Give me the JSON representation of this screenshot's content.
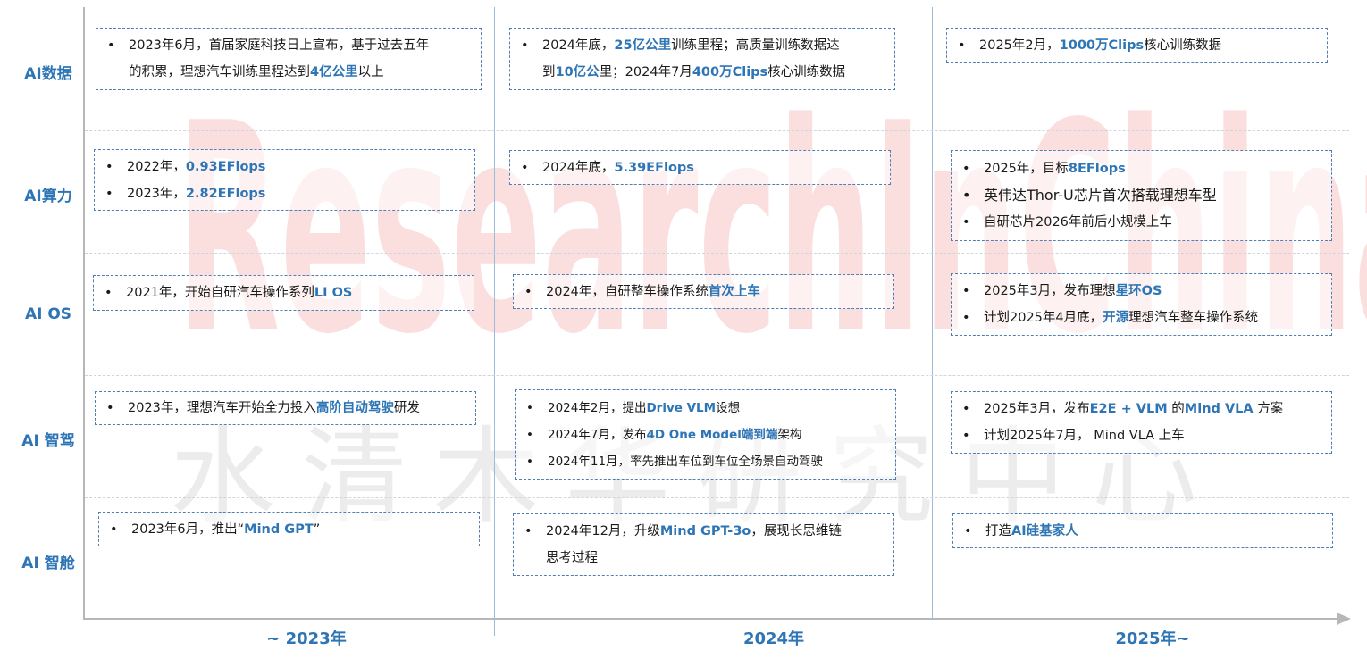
{
  "watermark": {
    "english_letters": [
      "R",
      "e",
      "s",
      "e",
      "a",
      "r",
      "c",
      "h",
      "I",
      "n",
      "C",
      "h",
      "i",
      "n",
      "a"
    ],
    "chinese_chars": [
      "水",
      "清",
      "木",
      "华",
      "研",
      "究",
      "中",
      "心"
    ]
  },
  "rows": [
    "AI数据",
    "AI算力",
    "AI OS",
    "AI 智驾",
    "AI 智舱"
  ],
  "years": [
    "~ 2023年",
    "2024年",
    "2025年~"
  ],
  "cells": {
    "data_2023": [
      [
        {
          "t": "2023年6月，首届家庭科技日上宣布，基于过去五年"
        }
      ],
      [
        {
          "t": "的积累，理想汽车训练里程达到"
        },
        {
          "t": "4亿公里",
          "h": true
        },
        {
          "t": "以上"
        }
      ]
    ],
    "data_2024": [
      [
        {
          "t": "2024年底，"
        },
        {
          "t": "25亿公里",
          "h": true
        },
        {
          "t": "训练里程；高质量训练数据达"
        }
      ],
      [
        {
          "t": "到"
        },
        {
          "t": "10亿公",
          "h": true
        },
        {
          "t": "里；2024年7月"
        },
        {
          "t": "400万Clips",
          "h": true
        },
        {
          "t": "核心训练数据"
        }
      ]
    ],
    "data_2025": [
      [
        {
          "t": "2025年2月，"
        },
        {
          "t": "1000万Clips",
          "h": true
        },
        {
          "t": "核心训练数据"
        }
      ]
    ],
    "compute_2023": [
      [
        {
          "t": "2022年，"
        },
        {
          "t": "0.93EFlops",
          "h": true
        }
      ],
      [
        {
          "t": "2023年，"
        },
        {
          "t": "2.82EFlops",
          "h": true
        }
      ]
    ],
    "compute_2024": [
      [
        {
          "t": "2024年底，"
        },
        {
          "t": "5.39EFlops",
          "h": true
        }
      ]
    ],
    "compute_2025": [
      [
        {
          "t": "2025年，目标"
        },
        {
          "t": "8EFlops",
          "h": true
        }
      ],
      [
        {
          "t": "英伟达Thor-U芯片首次搭载理想车型"
        }
      ],
      [
        {
          "t": "自研芯片2026年前后小规模上车"
        }
      ]
    ],
    "os_2023": [
      [
        {
          "t": "2021年，开始自研汽车操作系列"
        },
        {
          "t": "LI OS",
          "h": true
        }
      ]
    ],
    "os_2024": [
      [
        {
          "t": "2024年，自研整车操作系统"
        },
        {
          "t": "首次上车",
          "h": true
        }
      ]
    ],
    "os_2025": [
      [
        {
          "t": "2025年3月，发布理想"
        },
        {
          "t": "星环OS",
          "h": true
        }
      ],
      [
        {
          "t": "计划2025年4月底，"
        },
        {
          "t": "开源",
          "h": true
        },
        {
          "t": "理想汽车整车操作系统"
        }
      ]
    ],
    "drive_2023": [
      [
        {
          "t": "2023年，理想汽车开始全力投入"
        },
        {
          "t": "高阶自动驾驶",
          "h": true
        },
        {
          "t": "研发"
        }
      ]
    ],
    "drive_2024": [
      [
        {
          "t": "2024年2月，提出"
        },
        {
          "t": "Drive VLM",
          "h": true
        },
        {
          "t": "设想"
        }
      ],
      [
        {
          "t": "2024年7月，发布"
        },
        {
          "t": "4D One Model端到端",
          "h": true
        },
        {
          "t": "架构"
        }
      ],
      [
        {
          "t": "2024年11月，率先推出车位到车位全场景自动驾驶"
        }
      ]
    ],
    "drive_2025": [
      [
        {
          "t": "2025年3月，发布"
        },
        {
          "t": "E2E + VLM",
          "h": true
        },
        {
          "t": " 的"
        },
        {
          "t": "Mind VLA",
          "h": true
        },
        {
          "t": " 方案"
        }
      ],
      [
        {
          "t": "计划2025年7月， Mind VLA 上车"
        }
      ]
    ],
    "cabin_2023": [
      [
        {
          "t": "2023年6月，推出“"
        },
        {
          "t": "Mind GPT",
          "h": true
        },
        {
          "t": "”"
        }
      ]
    ],
    "cabin_2024": [
      [
        {
          "t": "2024年12月，升级"
        },
        {
          "t": "Mind  GPT-3o",
          "h": true
        },
        {
          "t": "，展现长思维链"
        }
      ],
      [
        {
          "t": "思考过程"
        }
      ]
    ],
    "cabin_2025": [
      [
        {
          "t": "打造"
        },
        {
          "t": "AI硅基家人",
          "h": true
        }
      ]
    ]
  }
}
